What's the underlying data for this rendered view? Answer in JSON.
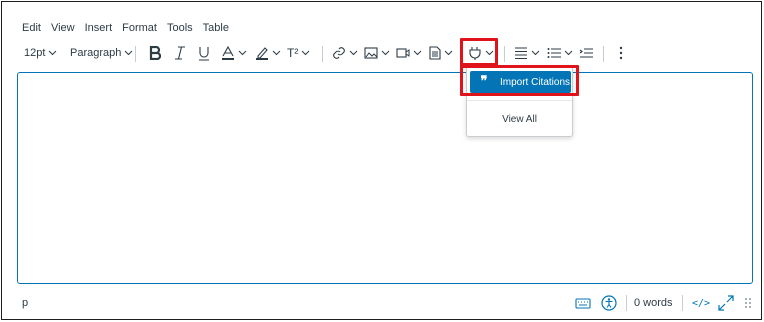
{
  "menubar": {
    "items": [
      "Edit",
      "View",
      "Insert",
      "Format",
      "Tools",
      "Table"
    ]
  },
  "toolbar": {
    "font_size": "12pt",
    "block_format": "Paragraph",
    "superscript_label": "T²",
    "icons": [
      "bold-icon",
      "italic-icon",
      "underline-icon",
      "text-color-icon",
      "highlight-color-icon",
      "superscript-icon",
      "link-icon",
      "image-icon",
      "media-icon",
      "document-icon",
      "apps-plugin-icon",
      "align-icon",
      "bullet-list-icon",
      "indent-icon",
      "more-options-icon"
    ]
  },
  "dropdown": {
    "import_citations": "Import Citations",
    "view_all": "View All"
  },
  "status": {
    "path": "p",
    "word_count": "0 words",
    "html_toggle": "</>"
  },
  "colors": {
    "accent": "#0374b5",
    "highlight": "#e0131a",
    "text": "#2d3b45"
  }
}
